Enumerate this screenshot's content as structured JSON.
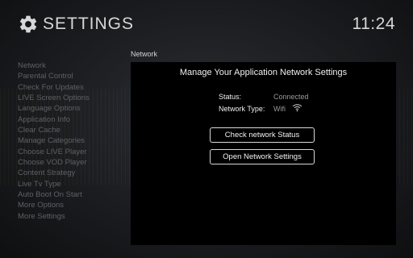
{
  "header": {
    "title": "SETTINGS",
    "clock": "11:24",
    "icon": "gear-icon"
  },
  "sidebar": {
    "items": [
      "Network",
      "Parental Control",
      "Check For Updates",
      "LIVE Screen Options",
      "Language Options",
      "Application Info",
      "Clear Cache",
      "Manage Categories",
      "Choose LIVE Player",
      "Choose VOD Player",
      "Content Strategy",
      "Live Tv Type",
      "Auto Boot On Start",
      "More Options",
      "More Settings"
    ]
  },
  "section_label": "Network",
  "panel": {
    "title": "Manage Your Application Network Settings",
    "status_label": "Status:",
    "status_value": "Connected",
    "network_type_label": "Network Type:",
    "network_type_value": "Wifi",
    "network_type_icon": "wifi-icon",
    "check_button": "Check network Status",
    "open_button": "Open Network Settings"
  },
  "colors": {
    "background": "#15171a",
    "panel": "#000000",
    "sidebar_text": "#5d6166",
    "text": "#f0f0f0"
  }
}
